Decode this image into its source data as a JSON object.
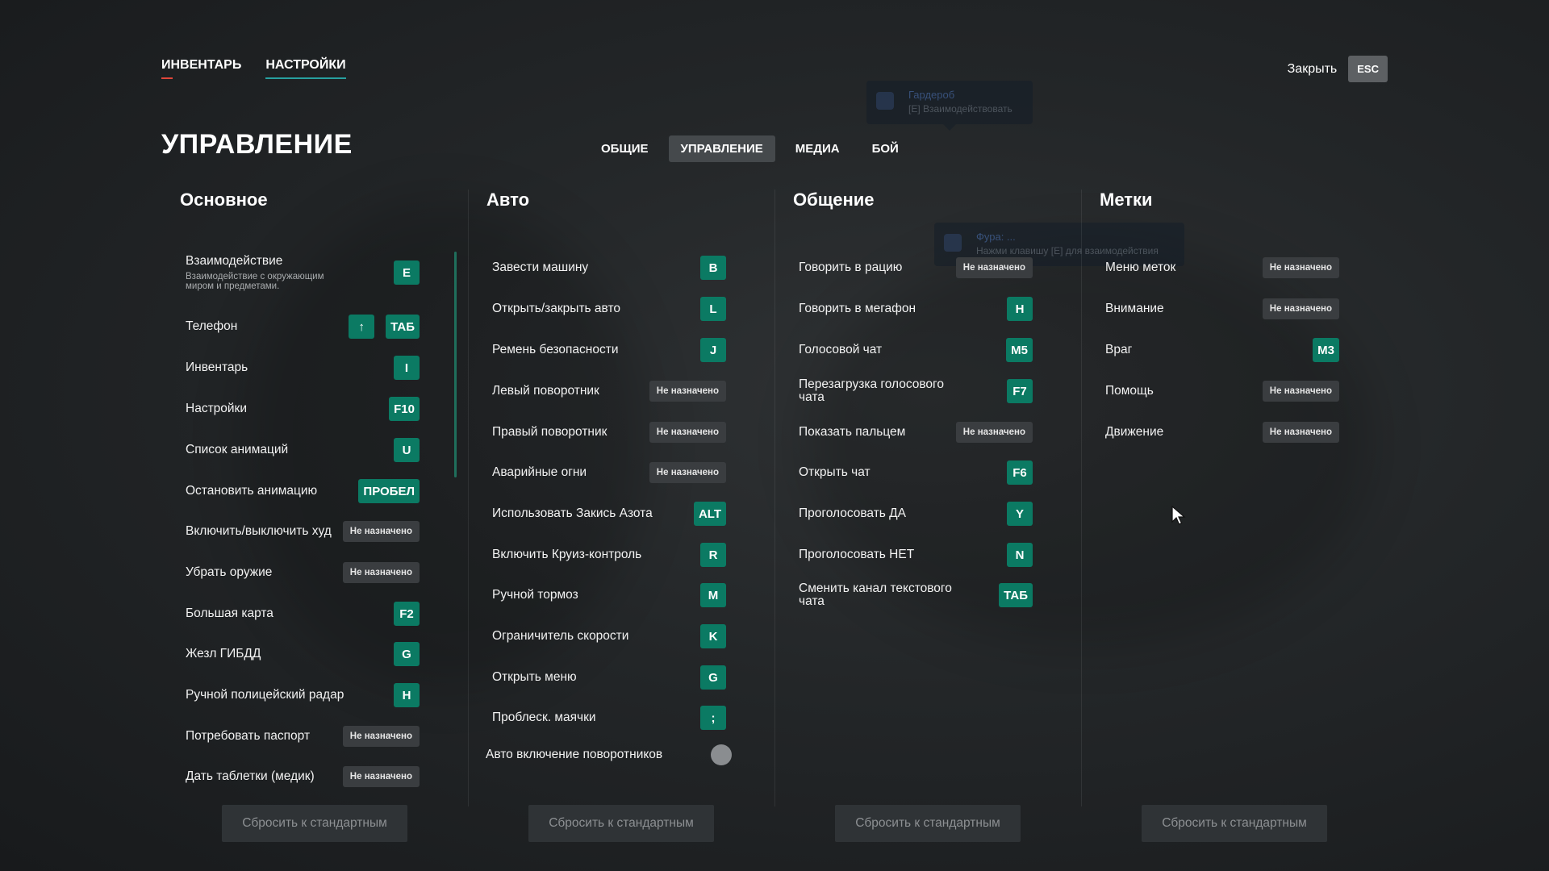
{
  "top_tabs": [
    {
      "label": "ИНВЕНТАРЬ"
    },
    {
      "label": "НАСТРОЙКИ"
    }
  ],
  "close": {
    "label": "Закрыть",
    "key": "ESC"
  },
  "page_title": "УПРАВЛЕНИЕ",
  "sub_tabs": [
    {
      "label": "ОБЩИЕ"
    },
    {
      "label": "УПРАВЛЕНИЕ"
    },
    {
      "label": "МЕДИА"
    },
    {
      "label": "БОЙ"
    }
  ],
  "bg_hints": [
    {
      "title": "Гардероб",
      "sub": "[E] Взаимодействовать"
    },
    {
      "title": "Фура: ...",
      "sub": "Нажми клавишу [E] для взаимодействия"
    }
  ],
  "columns": [
    {
      "title": "Основное",
      "rows": [
        {
          "label": "Взаимодействие",
          "desc": "Взаимодействие с окружающим миром и предметами.",
          "keys": [
            "E"
          ]
        },
        {
          "label": "Телефон",
          "keys": [
            "↑",
            "ТАБ"
          ]
        },
        {
          "label": "Инвентарь",
          "keys": [
            "I"
          ]
        },
        {
          "label": "Настройки",
          "keys": [
            "F10"
          ]
        },
        {
          "label": "Список анимаций",
          "keys": [
            "U"
          ]
        },
        {
          "label": "Остановить анимацию",
          "keys": [
            "ПРОБЕЛ"
          ]
        },
        {
          "label": "Включить/выключить худ",
          "keys": [
            "Не назначено"
          ]
        },
        {
          "label": "Убрать оружие",
          "keys": [
            "Не назначено"
          ]
        },
        {
          "label": "Большая карта",
          "keys": [
            "F2"
          ]
        },
        {
          "label": "Жезл ГИБДД",
          "keys": [
            "G"
          ]
        },
        {
          "label": "Ручной полицейский радар",
          "keys": [
            "H"
          ]
        },
        {
          "label": "Потребовать паспорт",
          "keys": [
            "Не назначено"
          ]
        },
        {
          "label": "Дать таблетки (медик)",
          "keys": [
            "Не назначено"
          ]
        }
      ],
      "reset": "Сбросить к стандартным"
    },
    {
      "title": "Авто",
      "rows": [
        {
          "label": "Завести машину",
          "keys": [
            "B"
          ]
        },
        {
          "label": "Открыть/закрыть авто",
          "keys": [
            "L"
          ]
        },
        {
          "label": "Ремень безопасности",
          "keys": [
            "J"
          ]
        },
        {
          "label": "Левый поворотник",
          "keys": [
            "Не назначено"
          ]
        },
        {
          "label": "Правый поворотник",
          "keys": [
            "Не назначено"
          ]
        },
        {
          "label": "Аварийные огни",
          "keys": [
            "Не назначено"
          ]
        },
        {
          "label": "Использовать Закись Азота",
          "keys": [
            "ALT"
          ]
        },
        {
          "label": "Включить Круиз-контроль",
          "keys": [
            "R"
          ]
        },
        {
          "label": "Ручной тормоз",
          "keys": [
            "M"
          ]
        },
        {
          "label": "Ограничитель скорости",
          "keys": [
            "K"
          ]
        },
        {
          "label": "Открыть меню",
          "keys": [
            "G"
          ]
        },
        {
          "label": "Проблеск. маячки",
          "keys": [
            ";"
          ]
        }
      ],
      "toggle": {
        "label": "Авто включение поворотников"
      },
      "reset": "Сбросить к стандартным"
    },
    {
      "title": "Общение",
      "rows": [
        {
          "label": "Говорить в рацию",
          "keys": [
            "Не назначено"
          ]
        },
        {
          "label": "Говорить в мегафон",
          "keys": [
            "H"
          ]
        },
        {
          "label": "Голосовой чат",
          "keys": [
            "M5"
          ]
        },
        {
          "label": "Перезагрузка голосового чата",
          "keys": [
            "F7"
          ]
        },
        {
          "label": "Показать пальцем",
          "keys": [
            "Не назначено"
          ]
        },
        {
          "label": "Открыть чат",
          "keys": [
            "F6"
          ]
        },
        {
          "label": "Проголосовать ДА",
          "keys": [
            "Y"
          ]
        },
        {
          "label": "Проголосовать НЕТ",
          "keys": [
            "N"
          ]
        },
        {
          "label": "Сменить канал текстового чата",
          "keys": [
            "ТАБ"
          ]
        }
      ],
      "reset": "Сбросить к стандартным"
    },
    {
      "title": "Метки",
      "rows": [
        {
          "label": "Меню меток",
          "keys": [
            "Не назначено"
          ]
        },
        {
          "label": "Внимание",
          "keys": [
            "Не назначено"
          ]
        },
        {
          "label": "Враг",
          "keys": [
            "M3"
          ]
        },
        {
          "label": "Помощь",
          "keys": [
            "Не назначено"
          ]
        },
        {
          "label": "Движение",
          "keys": [
            "Не назначено"
          ]
        }
      ],
      "reset": "Сбросить к стандартным"
    }
  ],
  "colors": {
    "key_bg": "#0b7a63",
    "unassigned_bg": "#3a3d40",
    "active_tab_bg": "#45494c",
    "accent_line": "#27a0a0"
  }
}
